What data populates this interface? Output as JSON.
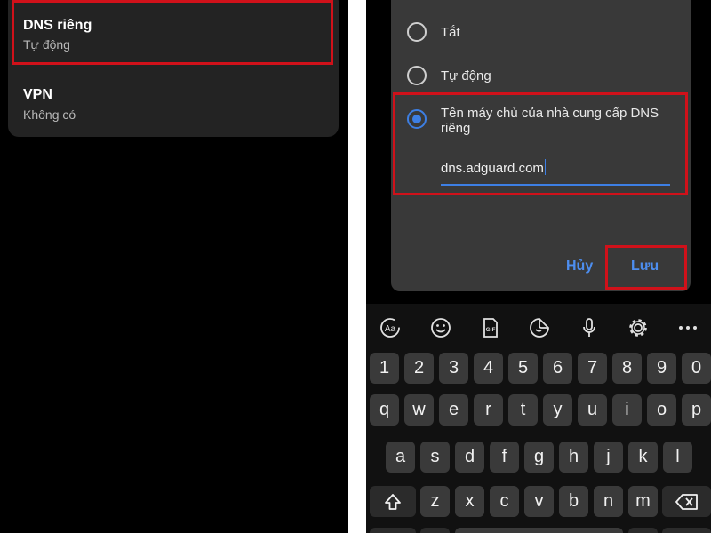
{
  "left_panel": {
    "dns": {
      "title": "DNS riêng",
      "subtitle": "Tự động"
    },
    "vpn": {
      "title": "VPN",
      "subtitle": "Không có"
    }
  },
  "dialog": {
    "options": [
      {
        "label": "Tắt",
        "selected": false
      },
      {
        "label": "Tự động",
        "selected": false
      },
      {
        "label": "Tên máy chủ của nhà cung cấp DNS riêng",
        "selected": true
      }
    ],
    "hostname_value": "dns.adguard.com",
    "cancel_label": "Hủy",
    "save_label": "Lưu"
  },
  "keyboard": {
    "toolbar": [
      "text-style-icon",
      "emoji-icon",
      "gif-icon",
      "sticker-icon",
      "microphone-icon",
      "gear-icon",
      "more-icon"
    ],
    "row_numbers": [
      "1",
      "2",
      "3",
      "4",
      "5",
      "6",
      "7",
      "8",
      "9",
      "0"
    ],
    "row1": [
      "q",
      "w",
      "e",
      "r",
      "t",
      "y",
      "u",
      "i",
      "o",
      "p"
    ],
    "row2": [
      "a",
      "s",
      "d",
      "f",
      "g",
      "h",
      "j",
      "k",
      "l"
    ],
    "row3": [
      "z",
      "x",
      "c",
      "v",
      "b",
      "n",
      "m"
    ]
  },
  "colors": {
    "accent": "#3d7fe4",
    "highlight": "#d0111a",
    "dialog_bg": "#393939",
    "card_bg": "#232323"
  }
}
